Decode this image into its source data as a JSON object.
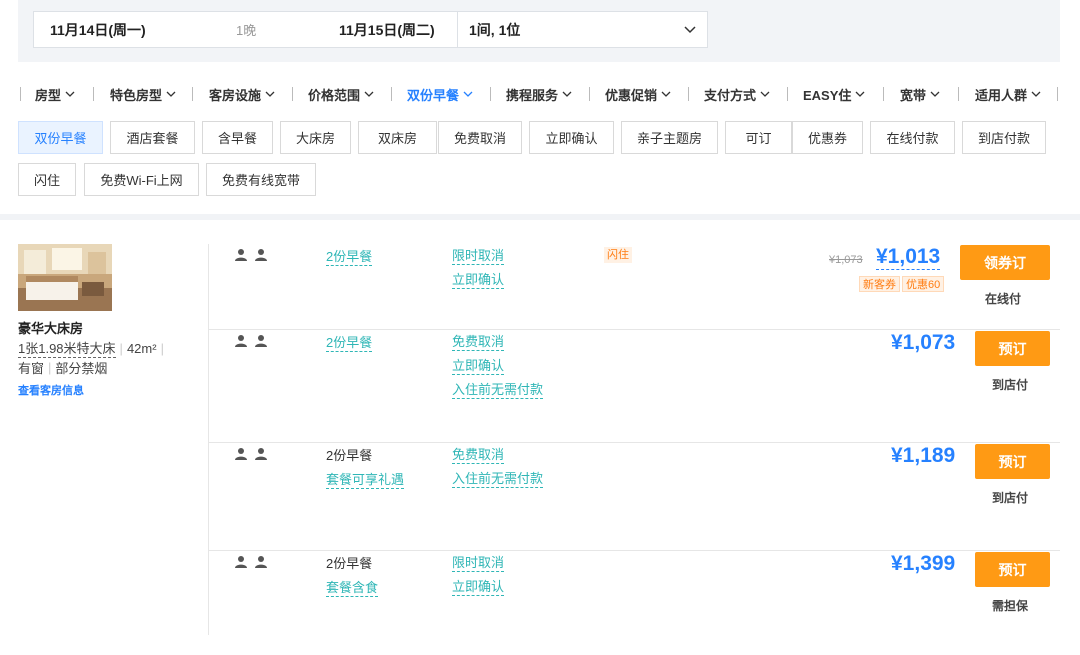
{
  "search": {
    "check_in": "11月14日(周一)",
    "nights": "1晚",
    "check_out": "11月15日(周二)",
    "rooms_guests": "1间, 1位"
  },
  "filters": [
    {
      "label": "房型",
      "active": false
    },
    {
      "label": "特色房型",
      "active": false
    },
    {
      "label": "客房设施",
      "active": false
    },
    {
      "label": "价格范围",
      "active": false
    },
    {
      "label": "双份早餐",
      "active": true
    },
    {
      "label": "携程服务",
      "active": false
    },
    {
      "label": "优惠促销",
      "active": false
    },
    {
      "label": "支付方式",
      "active": false
    },
    {
      "label": "EASY住",
      "active": false
    },
    {
      "label": "宽带",
      "active": false
    },
    {
      "label": "适用人群",
      "active": false
    }
  ],
  "tags": [
    {
      "label": "双份早餐",
      "selected": true
    },
    {
      "label": "酒店套餐",
      "selected": false
    },
    {
      "label": "含早餐",
      "selected": false
    },
    {
      "label": "大床房",
      "selected": false
    },
    {
      "label": "双床房",
      "selected": false
    },
    {
      "label": "免费取消",
      "selected": false
    },
    {
      "label": "立即确认",
      "selected": false
    },
    {
      "label": "亲子主题房",
      "selected": false
    },
    {
      "label": "可订",
      "selected": false
    },
    {
      "label": "优惠券",
      "selected": false
    },
    {
      "label": "在线付款",
      "selected": false
    },
    {
      "label": "到店付款",
      "selected": false
    },
    {
      "label": "闪住",
      "selected": false
    },
    {
      "label": "免费Wi-Fi上网",
      "selected": false
    },
    {
      "label": "免费有线宽带",
      "selected": false
    }
  ],
  "room": {
    "name": "豪华大床房",
    "bed": "1张1.98米特大床",
    "area": "42m²",
    "window": "有窗",
    "smoking": "部分禁烟",
    "info_link": "查看客房信息"
  },
  "rates": [
    {
      "breakfast": "2份早餐",
      "breakfast_link": true,
      "package": "",
      "policies": [
        "限时取消",
        "立即确认"
      ],
      "flash": "闪住",
      "original_price": "¥1,073",
      "price": "¥1,013",
      "badges": [
        "新客券",
        "优惠60"
      ],
      "button": "领券订",
      "payment": "在线付"
    },
    {
      "breakfast": "2份早餐",
      "breakfast_link": true,
      "package": "",
      "policies": [
        "免费取消",
        "立即确认",
        "入住前无需付款"
      ],
      "flash": "",
      "original_price": "",
      "price": "¥1,073",
      "badges": [],
      "button": "预订",
      "payment": "到店付"
    },
    {
      "breakfast": "2份早餐",
      "breakfast_link": false,
      "package": "套餐可享礼遇",
      "policies": [
        "免费取消",
        "入住前无需付款"
      ],
      "flash": "",
      "original_price": "",
      "price": "¥1,189",
      "badges": [],
      "button": "预订",
      "payment": "到店付"
    },
    {
      "breakfast": "2份早餐",
      "breakfast_link": false,
      "package": "套餐含食",
      "policies": [
        "限时取消",
        "立即确认"
      ],
      "flash": "",
      "original_price": "",
      "price": "¥1,399",
      "badges": [],
      "button": "预订",
      "payment": "需担保"
    }
  ],
  "colors": {
    "accent_blue": "#2681ff",
    "teal_link": "#2fb6b6",
    "book_orange": "#ff9a14",
    "promo_orange": "#ff7d13"
  }
}
